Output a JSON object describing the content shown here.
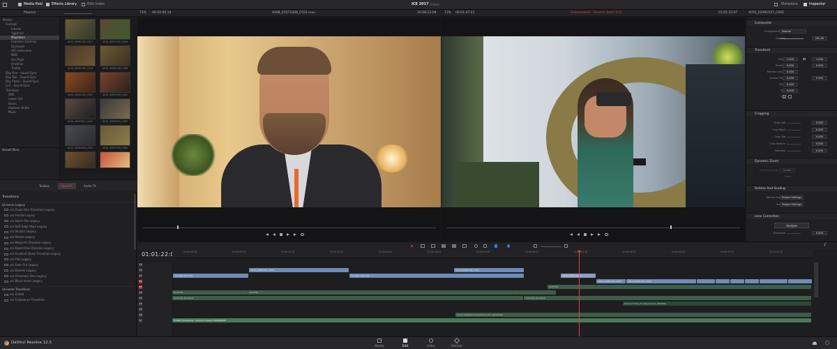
{
  "topbar": {
    "left_buttons": [
      "Media Pool",
      "Effects Library",
      "Edit Index"
    ],
    "project_title": "ICE 2017",
    "project_status": "Edited",
    "right_buttons": [
      "Metadata",
      "Inspector"
    ]
  },
  "subbar": {
    "bin_name": "Playlniz",
    "source_zoom": "73%",
    "source_timecode": "00:02:00:14",
    "source_clip_name": "A008_02071608_C031.mov",
    "source_duration": "16:08:22:08",
    "program_zoom": "73%",
    "program_timecode": "00:01:47:21",
    "timeline_name": "Sideshowrial - Sevens Qutel 119",
    "program_current": "01:01:22:07",
    "inspector_clip": "A010_02091037_C005"
  },
  "media_tree": {
    "items": [
      "Master",
      "Footage",
      "Interior",
      "Yggdrasil",
      "Playlinkss",
      "Evolution Gaming",
      "Quickspin",
      "VIS Codename",
      "NGD",
      "Ano'Pups",
      "Oneshus",
      "Trustly",
      "Day One - Sound Sync",
      "Day Two - Sound Sync",
      "Day Three - Sound Sync",
      "LnC - Sound Sync",
      "Timelines",
      "SMS",
      "Lower 3rd",
      "Overs",
      "Kaptions Audio",
      "Music"
    ],
    "selected_index": 4,
    "smart_bins_label": "Smart Bins"
  },
  "thumbnails": [
    "A010_02091102_C017",
    "A010_02091125_C018",
    "A010_02091108_C019",
    "A010_02091116_C058",
    "A010_02091122_C007",
    "A010_02091125_C001",
    "A010_02091021_C007",
    "A010_02091033_C005",
    "A010_02091050_C003",
    "A010_02091109_C004",
    "A010_02091031_C055",
    "A010_02091055_C008",
    "A010_02091025_C021",
    ""
  ],
  "effects": {
    "tabs": [
      "Toolbox",
      "OpenFX",
      "Audio FX"
    ],
    "active_tab": 1,
    "section_title": "Transitions",
    "group1": "Universe Legacy",
    "items1": [
      "uni.Zoom Blur Transition Legacy",
      "uni.Fractal Legacy",
      "uni.Swish Pan Legacy",
      "uni.Soft Edge Wipe Legacy",
      "uni.Shutter Legacy",
      "uni.Rotate Legacy",
      "uni.Magnetic Displace Legacy",
      "uni.Hyperdrive Dissolve Legacy",
      "uni.Gradient Noise Transition Legacy",
      "uni.Film Legacy",
      "uni.Fade Out Legacy",
      "uni.Dashes Legacy",
      "uni.Chromatic Blur Legacy",
      "uni.Block Invert Legacy"
    ],
    "group2": "Universe Transitions",
    "items2": [
      "uni.Unfold",
      "uni.Turbulence Transition"
    ]
  },
  "inspector": {
    "composite": {
      "title": "Composite",
      "mode_label": "Composite Mode",
      "mode_value": "Normal",
      "opacity_label": "Opacity",
      "opacity_value": "100.00"
    },
    "transform": {
      "title": "Transform",
      "rows": [
        {
          "label": "Zoom",
          "value": "1.000",
          "value2": "1.000"
        },
        {
          "label": "Position",
          "value": "0.000",
          "value2": "0.000"
        },
        {
          "label": "Rotation Angle",
          "value": "0.000"
        },
        {
          "label": "Anchor Point",
          "value": "0.000",
          "value2": "0.000"
        },
        {
          "label": "Pitch",
          "value": "0.000"
        },
        {
          "label": "Yaw",
          "value": "0.000"
        },
        {
          "label": "Flip",
          "value": ""
        }
      ]
    },
    "cropping": {
      "title": "Cropping",
      "rows": [
        {
          "label": "Crop Left",
          "value": "0.000"
        },
        {
          "label": "Crop Right",
          "value": "0.000"
        },
        {
          "label": "Crop Top",
          "value": "0.000"
        },
        {
          "label": "Crop Bottom",
          "value": "0.000"
        },
        {
          "label": "Softness",
          "value": "0.000"
        }
      ]
    },
    "dynamic_zoom": {
      "title": "Dynamic Zoom",
      "ease_label": "Dynamic Zoom Ease",
      "ease_value": "Linear",
      "swap_label": "Swap"
    },
    "scaling": {
      "title": "Retime And Scaling",
      "retime_label": "Retime Process",
      "retime_value": "Project Settings",
      "scaling_label": "Scaling",
      "scaling_value": "Project Settings"
    },
    "lens": {
      "title": "Lens Correction",
      "analyze_label": "Analyze",
      "distortion_label": "Distortion",
      "distortion_value": "0.000"
    }
  },
  "timeline": {
    "current_tc": "01:01:22:07",
    "ruler": [
      "01:00:00:00",
      "01:00:05:05",
      "01:00:10:10",
      "01:00:15:15",
      "01:00:20:20",
      "01:00:26:01",
      "01:00:31:06",
      "01:00:36:11",
      "01:00:41:16",
      "01:00:46:21",
      "01:00:52:02",
      "01:00:57:07",
      "01:01:02:12"
    ],
    "tracks": [
      "V4",
      "V3",
      "V2",
      "V1",
      "A1",
      "A2",
      "A3",
      "A4",
      "A5",
      "A6",
      "A7"
    ],
    "clip_labels": {
      "v3_a": "A010_02091101_C058",
      "v3_b": "A010_02091109_C005",
      "v2_a": "Soma1R_Marvilat",
      "v2_b": "Soma1R_Marvilat",
      "v2_c": "A010_02091_C003",
      "v1_a": "A010_02091101_C003",
      "v1_b": "A010_02091101_C003",
      "a1_a": "SLOTTER",
      "a1_b": "SLOTTER",
      "a2_a": "SLOTTER",
      "a2_b": "SLOTTER",
      "a3_a": "Simon1R_Randolet",
      "a3_b": "Simon1R_Randolet",
      "a5": "Jenuit-fnatbhand paradorrer.cam_djanbfstile",
      "a6": "IC3000_Sindonilive - Sommer Queen 1900000000",
      "a4": "Sebrup Hi Brg Vor Ruponment_1999999"
    }
  },
  "app": {
    "name": "DaVinci Resolve 12.5"
  },
  "pages": {
    "items": [
      "Media",
      "Edit",
      "Color",
      "Deliver"
    ],
    "active": 1
  }
}
